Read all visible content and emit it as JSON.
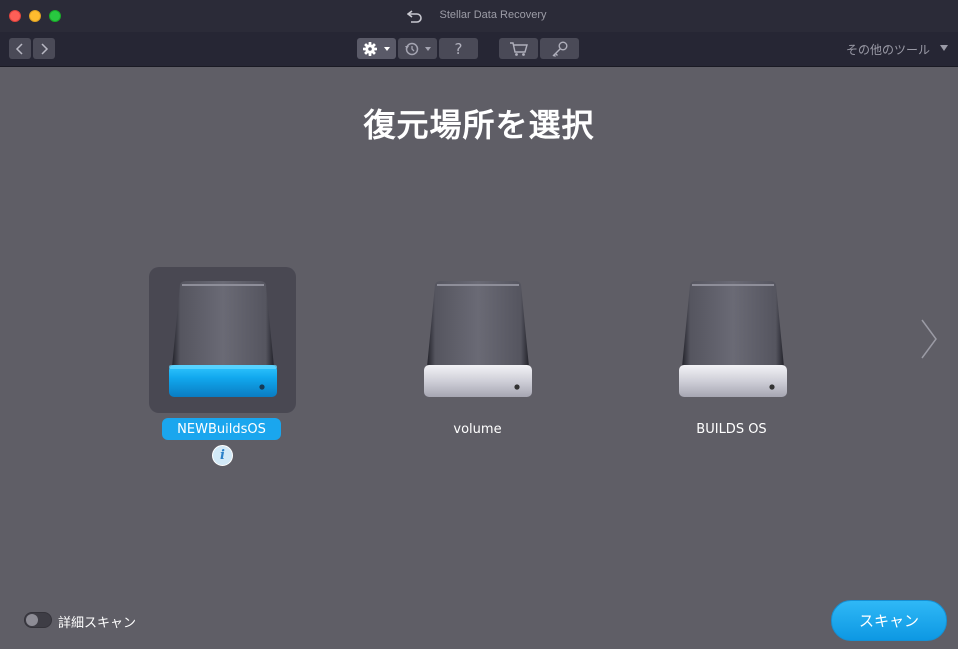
{
  "window": {
    "title": "Stellar Data Recovery"
  },
  "toolbar": {
    "back_icon": "chevron-left-icon",
    "forward_icon": "chevron-right-icon",
    "settings_icon": "gear-icon",
    "history_icon": "history-icon",
    "help_label": "?",
    "cart_icon": "cart-icon",
    "key_icon": "key-icon",
    "more_tools_label": "その他のツール"
  },
  "main": {
    "heading": "復元場所を選択",
    "drives": [
      {
        "label": "NEWBuildsOS",
        "selected": true
      },
      {
        "label": "volume",
        "selected": false
      },
      {
        "label": "BUILDS OS",
        "selected": false
      }
    ],
    "info_label": "i"
  },
  "footer": {
    "deep_scan_label": "詳細スキャン",
    "deep_scan_enabled": false,
    "scan_button_label": "スキャン"
  },
  "colors": {
    "accent": "#1aa6ee",
    "background": "#5f5e66",
    "titlebar": "#2b2b38"
  }
}
